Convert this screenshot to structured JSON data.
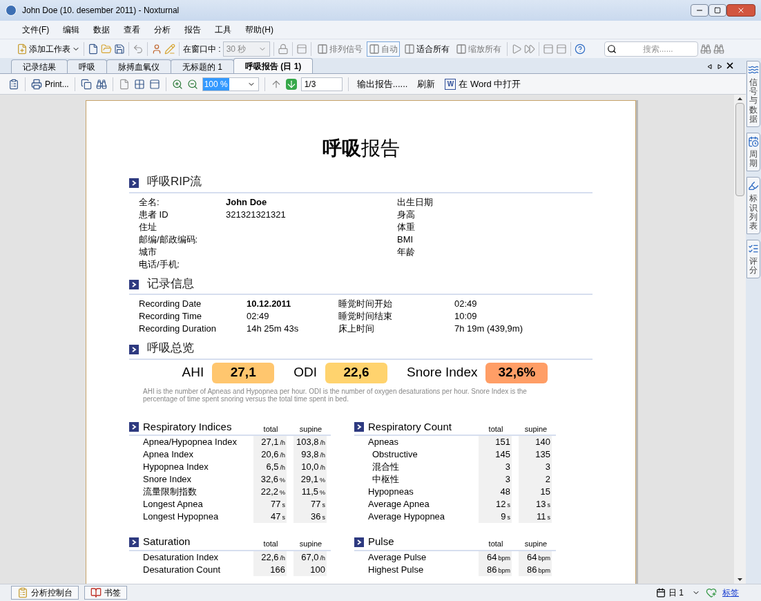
{
  "window": {
    "title": "John Doe (10. desember 2011)  - Noxturnal"
  },
  "menu": [
    "文件(F)",
    "编辑",
    "数据",
    "查看",
    "分析",
    "报告",
    "工具",
    "帮助(H)"
  ],
  "toolbar": {
    "add_sheet": "添加工作表",
    "window_label": "在窗口中 :",
    "window_select": "30 秒",
    "text_buttons": [
      {
        "label": "排列信号",
        "selected": false,
        "disabled": true
      },
      {
        "label": "自动",
        "selected": true,
        "disabled": true
      },
      {
        "label": "适合所有",
        "selected": false,
        "disabled": false
      },
      {
        "label": "缩放所有",
        "selected": false,
        "disabled": true
      }
    ],
    "search": {
      "placeholder": "搜索......"
    }
  },
  "tabs": [
    {
      "label": "记录结果",
      "selected": false
    },
    {
      "label": "呼吸",
      "selected": false
    },
    {
      "label": "脉搏血氧仪",
      "selected": false
    },
    {
      "label": "无标题的 1",
      "selected": false
    },
    {
      "label": "呼吸报告 (日 1)",
      "selected": true
    }
  ],
  "report_toolbar": {
    "word_icon": "W",
    "print": "Print...",
    "zoom": "100 %",
    "page": "1/3",
    "export": "输出报告......",
    "refresh": "刷新",
    "open_word": "在 Word 中打开"
  },
  "report": {
    "title": "**呼吸**报告",
    "patient": {
      "heading": "呼吸RIP流",
      "left": [
        {
          "label": "全名:",
          "value": "John Doe"
        },
        {
          "label": "患者 ID",
          "value": "321321321321"
        },
        {
          "label": "住址"
        },
        {
          "label": "邮编/邮政编码:"
        },
        {
          "label": "城市"
        },
        {
          "label": "电话/手机:"
        }
      ],
      "right": [
        "出生日期",
        "身高",
        "体重",
        "BMI",
        "年龄"
      ]
    },
    "recording": {
      "heading": "记录信息",
      "rows": [
        [
          "Recording Date",
          "10.12.2011",
          "睡觉时间开始",
          "02:49"
        ],
        [
          "Recording Time",
          "02:49",
          "睡觉时间结束",
          "10:09"
        ],
        [
          "Recording Duration",
          "14h 25m 43s",
          "床上时间",
          "7h 19m (439,9m)"
        ]
      ]
    },
    "overview": {
      "heading": "呼吸总览",
      "metrics": [
        {
          "label": "AHI",
          "value": "27,1",
          "color": "#ffc66e"
        },
        {
          "label": "ODI",
          "value": "22,6",
          "color": "#ffd36e"
        },
        {
          "label": "Snore Index",
          "value": "32,6%",
          "color": "#ff9e66"
        }
      ],
      "note": "AHI is the number of Apneas and Hypopnea per hour. ODI is the number of oxygen desaturations per hour. Snore Index is the percentage of time spent snoring  versus the total time spent in bed."
    },
    "tables": [
      {
        "title": "Respiratory Indices",
        "columns": [
          "total",
          "supine"
        ],
        "rows": [
          {
            "label": "Apnea/Hypopnea Index",
            "total": "27,1",
            "total_unit": "/h",
            "supine": "103,8",
            "supine_unit": "/h"
          },
          {
            "label": "Apnea Index",
            "total": "20,6",
            "total_unit": "/h",
            "supine": "93,8",
            "supine_unit": "/h"
          },
          {
            "label": "Hypopnea Index",
            "total": "6,5",
            "total_unit": "/h",
            "supine": "10,0",
            "supine_unit": "/h"
          },
          {
            "label": "Snore Index",
            "total": "32,6",
            "total_unit": "%",
            "supine": "29,1",
            "supine_unit": "%"
          },
          {
            "label": "流量限制指数",
            "total": "22,2",
            "total_unit": "%",
            "supine": "11,5",
            "supine_unit": "%"
          },
          {
            "label": "Longest Apnea",
            "total": "77",
            "total_unit": "s",
            "supine": "77",
            "supine_unit": "s"
          },
          {
            "label": "Longest Hypopnea",
            "total": "47",
            "total_unit": "s",
            "supine": "36",
            "supine_unit": "s"
          }
        ]
      },
      {
        "title": "Respiratory Count",
        "columns": [
          "total",
          "supine"
        ],
        "rows": [
          {
            "label": "Apneas",
            "total": "151",
            "supine": "140",
            "children": [
              {
                "label": "Obstructive",
                "total": "145",
                "supine": "135"
              },
              {
                "label": "混合性",
                "total": "3",
                "supine": "3"
              },
              {
                "label": "中枢性",
                "total": "3",
                "supine": "2"
              }
            ]
          },
          {
            "label": "Hypopneas",
            "total": "48",
            "supine": "15"
          },
          {
            "label": "Average Apnea",
            "total": "12",
            "total_unit": "s",
            "supine": "13",
            "supine_unit": "s"
          },
          {
            "label": "Average Hypopnea",
            "total": "9",
            "total_unit": "s",
            "supine": "11",
            "supine_unit": "s"
          }
        ]
      },
      {
        "title": "Saturation",
        "columns": [
          "total",
          "supine"
        ],
        "rows": [
          {
            "label": "Desaturation Index",
            "total": "22,6",
            "total_unit": "/h",
            "supine": "67,0",
            "supine_unit": "/h"
          },
          {
            "label": "Desaturation Count",
            "total": "166",
            "supine": "100"
          }
        ]
      },
      {
        "title": "Pulse",
        "columns": [
          "total",
          "supine"
        ],
        "rows": [
          {
            "label": "Average Pulse",
            "total": "64",
            "total_unit": "bpm",
            "supine": "64",
            "supine_unit": "bpm"
          },
          {
            "label": "Highest Pulse",
            "total": "86",
            "total_unit": "bpm",
            "supine": "86",
            "supine_unit": "bpm"
          }
        ]
      }
    ]
  },
  "side_tabs": [
    "信号与数据",
    "周期",
    "标识列表",
    "评分"
  ],
  "status_bar": {
    "tabs": [
      "分析控制台",
      "书签"
    ],
    "day": "日 1",
    "link": "标签"
  }
}
